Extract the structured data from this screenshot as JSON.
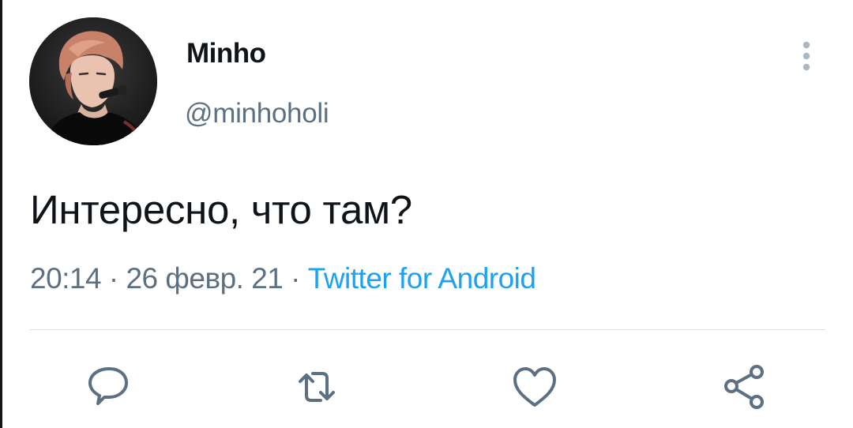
{
  "tweet": {
    "author": {
      "display_name": "Minho",
      "handle": "@minhoholi"
    },
    "text": "Интересно, что там?",
    "meta": {
      "time": "20:14",
      "separator": " · ",
      "date": "26 февр. 21",
      "source": "Twitter for Android"
    },
    "actions": [
      {
        "icon": "reply-icon"
      },
      {
        "icon": "retweet-icon"
      },
      {
        "icon": "like-icon"
      },
      {
        "icon": "share-icon"
      }
    ]
  },
  "colors": {
    "text": "#0f1419",
    "secondary": "#5b7083",
    "accent": "#1da1f2",
    "icon": "#5b7083",
    "divider": "#d9dee2"
  }
}
